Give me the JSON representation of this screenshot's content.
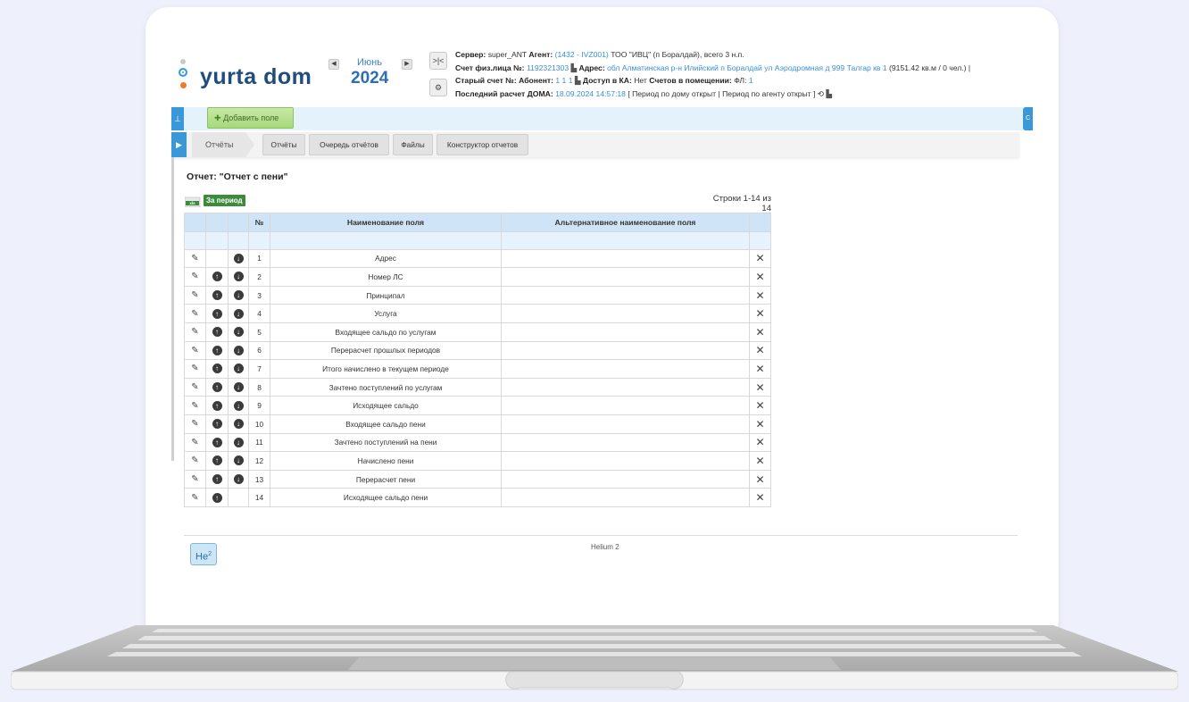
{
  "brand": {
    "logo_text": "yurta dom",
    "accent": "#3a98d8",
    "logo_color": "#214d7c"
  },
  "period": {
    "prev_icon": "triangle-left-icon",
    "next_icon": "triangle-right-icon",
    "month": "Июнь",
    "year": "2024"
  },
  "tools": {
    "compare_label": ">|<",
    "settings_icon": "gear-icon"
  },
  "info": {
    "line1": {
      "server_label": "Сервер:",
      "server_value": "super_ANT",
      "agent_label": "Агент:",
      "agent_code": "(1432 - IVZ001)",
      "agent_rest": "ТОО \"ИВЦ\" (п Боралдай), всего 3 н.п."
    },
    "line2": {
      "account_label": "Счет физ.лица №:",
      "account_value": "1192321303",
      "address_label": "Адрес:",
      "address_value": "обл Алматинская р-н Илийский п Боралдай ул Аэродромная д 999 Талгар кв 1",
      "address_tail": "(9151.42 кв.м / 0 чел.) |"
    },
    "line3": {
      "old_account_label": "Старый счет №:",
      "subscriber_label": "Абонент:",
      "subscriber_value": "1 1 1",
      "ka_label": "Доступ в КА:",
      "ka_value": "Нет",
      "room_label": "Счетов в помещении:",
      "fl_label": "ФЛ:",
      "fl_value": "1"
    },
    "line4": {
      "last_calc_label": "Последний расчет ДОМА:",
      "last_calc_value": "18.09.2024 14:57:18",
      "status": "[ Период по дому открыт | Период по агенту открыт ]"
    }
  },
  "toolbar": {
    "add_field_label": "Добавить поле",
    "right_tab_label": "С"
  },
  "tabs": {
    "breadcrumb": "Отчёты",
    "items": [
      {
        "label": "Отчёты"
      },
      {
        "label": "Очередь отчётов"
      },
      {
        "label": "Файлы"
      },
      {
        "label": "Конструктор отчетов"
      }
    ]
  },
  "report": {
    "title": "Отчет: \"Отчет с пени\"",
    "xls_label": "xls",
    "period_badge": "За период",
    "rows_count": "Строки 1-14 из 14"
  },
  "table": {
    "headers": {
      "num": "№",
      "name": "Наименование поля",
      "alt_name": "Альтернативное наименование поля"
    },
    "rows": [
      {
        "n": "1",
        "name": "Адрес",
        "up": false,
        "down": true
      },
      {
        "n": "2",
        "name": "Номер ЛС",
        "up": true,
        "down": true
      },
      {
        "n": "3",
        "name": "Принципал",
        "up": true,
        "down": true
      },
      {
        "n": "4",
        "name": "Услуга",
        "up": true,
        "down": true
      },
      {
        "n": "5",
        "name": "Входящее сальдо по услугам",
        "up": true,
        "down": true
      },
      {
        "n": "6",
        "name": "Перерасчет прошлых периодов",
        "up": true,
        "down": true
      },
      {
        "n": "7",
        "name": "Итого начислено в текущем периоде",
        "up": true,
        "down": true
      },
      {
        "n": "8",
        "name": "Зачтено поступлений по услугам",
        "up": true,
        "down": true
      },
      {
        "n": "9",
        "name": "Исходящее сальдо",
        "up": true,
        "down": true
      },
      {
        "n": "10",
        "name": "Входящее сальдо пени",
        "up": true,
        "down": true
      },
      {
        "n": "11",
        "name": "Зачтено поступлений на пени",
        "up": true,
        "down": true
      },
      {
        "n": "12",
        "name": "Начислено пени",
        "up": true,
        "down": true
      },
      {
        "n": "13",
        "name": "Перерасчет пени",
        "up": true,
        "down": true
      },
      {
        "n": "14",
        "name": "Исходящее сальдо пени",
        "up": true,
        "down": false
      }
    ]
  },
  "footer": {
    "badge": "He",
    "badge_sup": "2",
    "text": "Helium 2"
  }
}
